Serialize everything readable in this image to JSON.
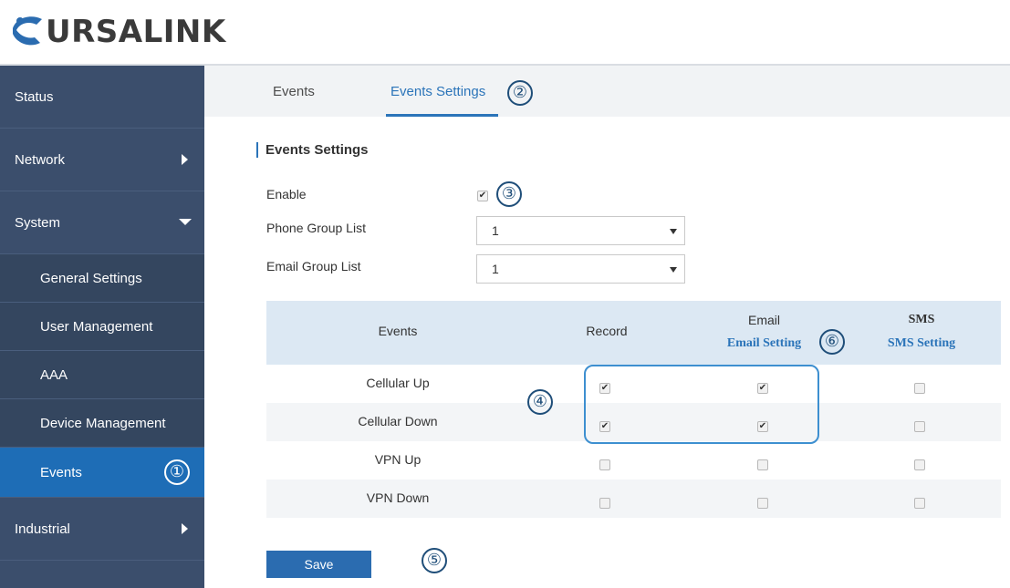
{
  "brand": {
    "logo_text": "URSALINK",
    "logo_color": "#3a3a3a",
    "accent": "#2b74b9"
  },
  "sidebar": {
    "items": [
      {
        "label": "Status",
        "type": "top"
      },
      {
        "label": "Network",
        "type": "top",
        "arrow": "right"
      },
      {
        "label": "System",
        "type": "top",
        "arrow": "down"
      },
      {
        "label": "General Settings",
        "type": "sub"
      },
      {
        "label": "User Management",
        "type": "sub"
      },
      {
        "label": "AAA",
        "type": "sub"
      },
      {
        "label": "Device Management",
        "type": "sub"
      },
      {
        "label": "Events",
        "type": "sub",
        "active": true,
        "badge": "①"
      },
      {
        "label": "Industrial",
        "type": "top",
        "arrow": "right"
      }
    ]
  },
  "tabs": [
    {
      "label": "Events",
      "active": false
    },
    {
      "label": "Events Settings",
      "active": true,
      "badge": "②"
    }
  ],
  "section": {
    "title": "Events Settings",
    "enable": {
      "label": "Enable",
      "checked": true,
      "badge": "③"
    },
    "phone_group": {
      "label": "Phone Group List",
      "value": "1"
    },
    "email_group": {
      "label": "Email Group List",
      "value": "1"
    }
  },
  "table": {
    "headers": {
      "events": "Events",
      "record": "Record",
      "email": "Email",
      "email_link": "Email Setting",
      "sms": "SMS",
      "sms_link": "SMS Setting"
    },
    "email_badge": "⑥",
    "callout_badge": "④",
    "rows": [
      {
        "event": "Cellular Up",
        "record": true,
        "email": true,
        "sms": false
      },
      {
        "event": "Cellular Down",
        "record": true,
        "email": true,
        "sms": false
      },
      {
        "event": "VPN Up",
        "record": false,
        "email": false,
        "sms": false
      },
      {
        "event": "VPN Down",
        "record": false,
        "email": false,
        "sms": false
      }
    ]
  },
  "save": {
    "label": "Save",
    "badge": "⑤"
  }
}
